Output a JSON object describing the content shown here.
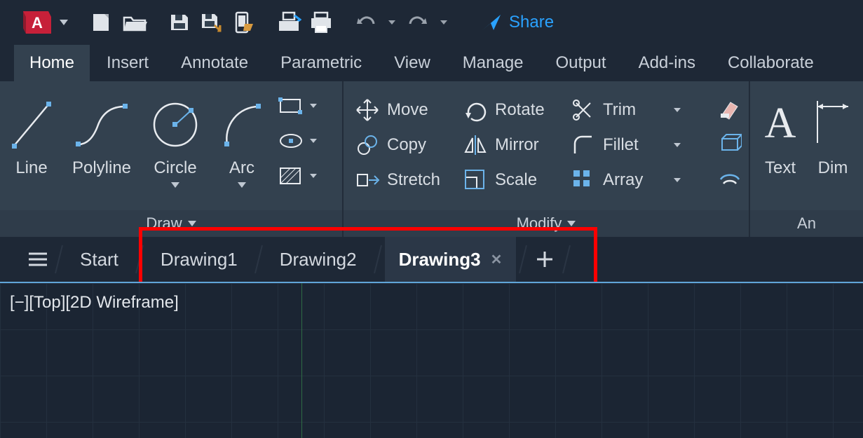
{
  "accent_blue": "#2aa2ff",
  "qat": {
    "share_label": "Share"
  },
  "ribbon_tabs": [
    "Home",
    "Insert",
    "Annotate",
    "Parametric",
    "View",
    "Manage",
    "Output",
    "Add-ins",
    "Collaborate"
  ],
  "ribbon_tabs_active_index": 0,
  "panels": {
    "draw": {
      "title": "Draw",
      "tools": {
        "line": "Line",
        "polyline": "Polyline",
        "circle": "Circle",
        "arc": "Arc"
      }
    },
    "modify": {
      "title": "Modify",
      "tools": {
        "move": "Move",
        "rotate": "Rotate",
        "trim": "Trim",
        "copy": "Copy",
        "mirror": "Mirror",
        "fillet": "Fillet",
        "stretch": "Stretch",
        "scale": "Scale",
        "array": "Array"
      }
    },
    "annotation": {
      "title": "An",
      "tools": {
        "text": "Text",
        "dimension": "Dim"
      }
    }
  },
  "file_tabs": {
    "start": "Start",
    "items": [
      "Drawing1",
      "Drawing2",
      "Drawing3"
    ],
    "active_index": 2
  },
  "viewport": {
    "label": "[−][Top][2D Wireframe]"
  }
}
